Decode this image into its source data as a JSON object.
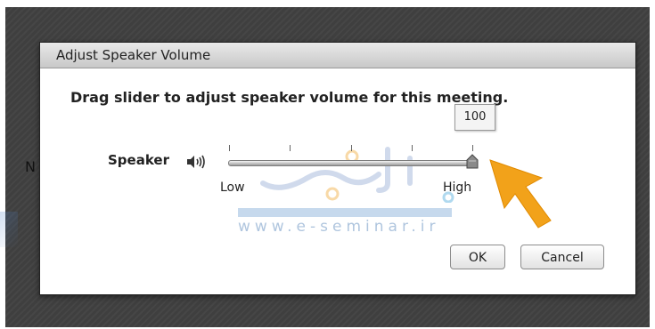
{
  "dialog": {
    "title": "Adjust Speaker Volume",
    "instruction": "Drag slider to adjust speaker volume for this meeting.",
    "speaker_label": "Speaker",
    "value_tooltip": "100",
    "slider": {
      "value": 100,
      "min_label": "Low",
      "max_label": "High"
    },
    "ok_label": "OK",
    "cancel_label": "Cancel"
  },
  "background": {
    "partial_letter": "N"
  },
  "watermark": {
    "url": "www.e-seminar.ir"
  },
  "colors": {
    "cursor": "#f2a21a",
    "titlebar": "#d6d6d6",
    "backdrop": "#3f3f3f"
  },
  "icons": [
    "speaker-volume-icon",
    "slider-thumb-icon",
    "pointer-arrow-icon"
  ]
}
